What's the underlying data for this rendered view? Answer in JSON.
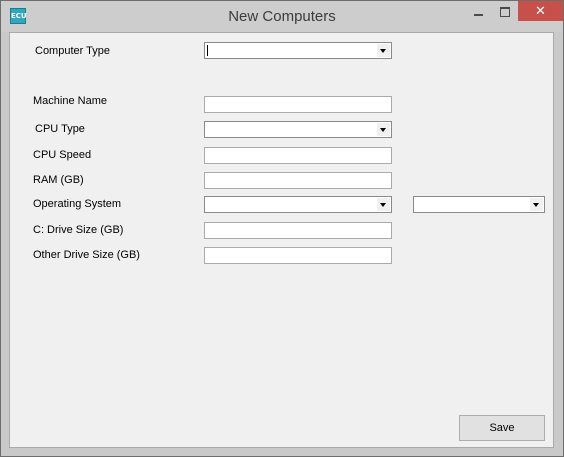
{
  "window": {
    "title": "New Computers",
    "app_icon_text": "ECU",
    "controls": {
      "close_symbol": "✕"
    }
  },
  "form": {
    "computer_type": {
      "label": "Computer Type",
      "value": ""
    },
    "machine_name": {
      "label": "Machine Name",
      "value": ""
    },
    "cpu_type": {
      "label": "CPU Type",
      "value": ""
    },
    "cpu_speed": {
      "label": "CPU Speed",
      "value": ""
    },
    "ram": {
      "label": "RAM (GB)",
      "value": ""
    },
    "operating_system": {
      "label": "Operating System",
      "value": "",
      "secondary_value": ""
    },
    "c_drive_size": {
      "label": "C: Drive Size (GB)",
      "value": ""
    },
    "other_drive_size": {
      "label": "Other Drive Size (GB)",
      "value": ""
    }
  },
  "actions": {
    "save_label": "Save"
  }
}
